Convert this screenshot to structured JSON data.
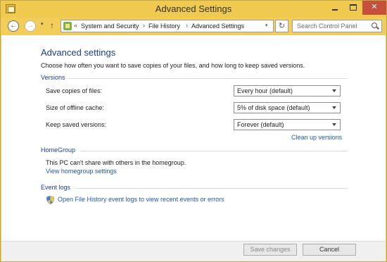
{
  "window": {
    "title": "Advanced Settings",
    "controls": {
      "minimize": "",
      "maximize": "",
      "close": "✕"
    }
  },
  "navbar": {
    "back": "←",
    "forward": "→",
    "recent": "▾",
    "up": "↑",
    "breadcrumb_sep0": "«",
    "breadcrumbs": [
      "System and Security",
      "File History",
      "Advanced Settings"
    ],
    "separator": "›",
    "address_dropdown": "▾",
    "refresh": "↻",
    "search_placeholder": "Search Control Panel"
  },
  "main": {
    "title": "Advanced settings",
    "description": "Choose how often you want to save copies of your files, and how long to keep saved versions.",
    "versions": {
      "heading": "Versions",
      "rows": [
        {
          "label": "Save copies of files:",
          "value": "Every hour (default)"
        },
        {
          "label": "Size of offline cache:",
          "value": "5% of disk space (default)"
        },
        {
          "label": "Keep saved versions:",
          "value": "Forever (default)"
        }
      ],
      "cleanup_link": "Clean up versions"
    },
    "homegroup": {
      "heading": "HomeGroup",
      "status": "This PC can't share with others in the homegroup.",
      "link": "View homegroup settings"
    },
    "event_logs": {
      "heading": "Event logs",
      "link": "Open File History event logs to view recent events or errors"
    }
  },
  "footer": {
    "save_label": "Save changes",
    "cancel_label": "Cancel"
  },
  "colors": {
    "title_bar": "#f0c94f",
    "heading_blue": "#1c3d8f",
    "link_blue": "#1f56b3",
    "close_red": "#c7503a"
  }
}
